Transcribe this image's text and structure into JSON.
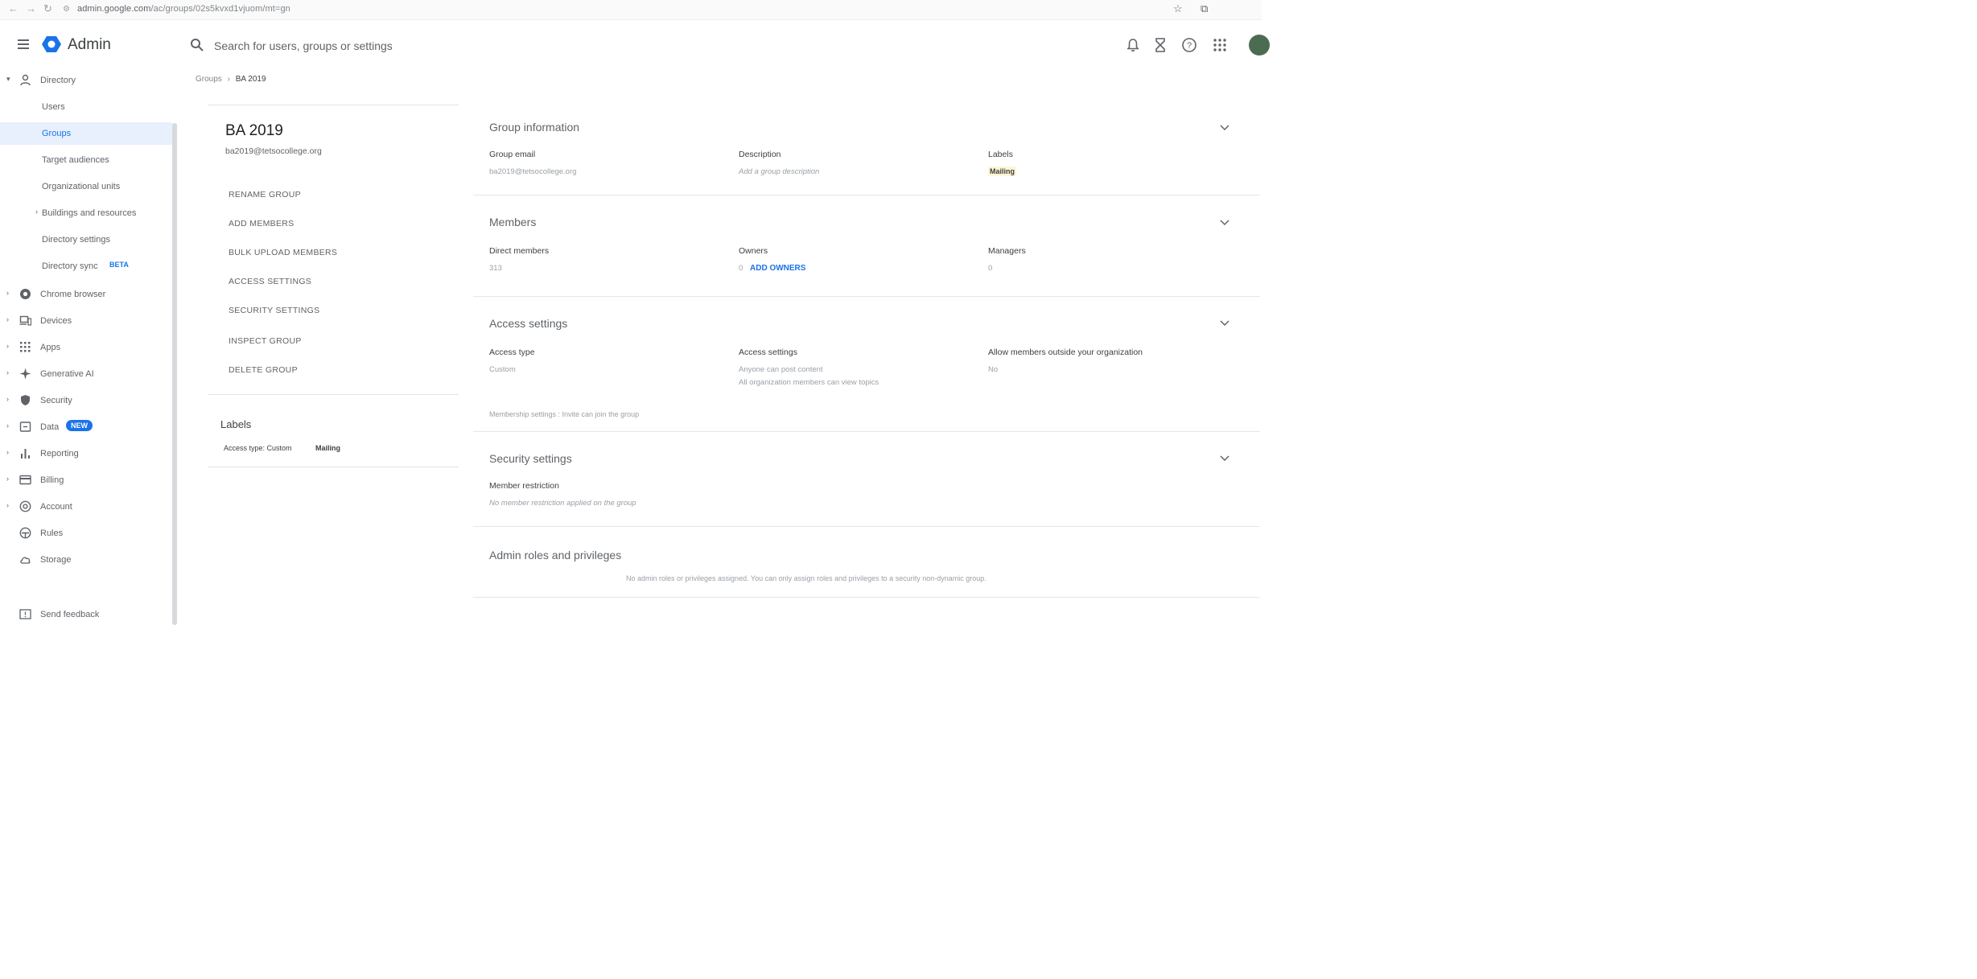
{
  "browser": {
    "url_domain": "admin.google.com",
    "url_path": "/ac/groups/02s5kvxd1vjuom/mt=gn"
  },
  "header": {
    "app_name": "Admin",
    "search_placeholder": "Search for users, groups or settings"
  },
  "sidebar": {
    "directory_label": "Directory",
    "directory_items": [
      {
        "label": "Users"
      },
      {
        "label": "Groups"
      },
      {
        "label": "Target audiences"
      },
      {
        "label": "Organizational units"
      },
      {
        "label": "Buildings and resources"
      },
      {
        "label": "Directory settings"
      },
      {
        "label": "Directory sync",
        "badge": "BETA"
      }
    ],
    "sections": [
      {
        "label": "Chrome browser",
        "icon": "chrome-icon"
      },
      {
        "label": "Devices",
        "icon": "devices-icon"
      },
      {
        "label": "Apps",
        "icon": "apps-grid-icon"
      },
      {
        "label": "Generative AI",
        "icon": "sparkle-icon"
      },
      {
        "label": "Security",
        "icon": "shield-icon"
      },
      {
        "label": "Data",
        "icon": "data-icon",
        "badge": "NEW"
      },
      {
        "label": "Reporting",
        "icon": "bar-chart-icon"
      },
      {
        "label": "Billing",
        "icon": "credit-card-icon"
      },
      {
        "label": "Account",
        "icon": "at-sign-icon"
      },
      {
        "label": "Rules",
        "icon": "rules-icon"
      },
      {
        "label": "Storage",
        "icon": "cloud-icon"
      }
    ],
    "feedback_label": "Send feedback"
  },
  "breadcrumb": {
    "parent": "Groups",
    "separator": "›",
    "current": "BA 2019"
  },
  "group_card": {
    "name": "BA 2019",
    "email": "ba2019@tetsocollege.org",
    "actions": [
      "RENAME GROUP",
      "ADD MEMBERS",
      "BULK UPLOAD MEMBERS",
      "ACCESS SETTINGS",
      "SECURITY SETTINGS",
      "INSPECT GROUP",
      "DELETE GROUP"
    ],
    "labels_title": "Labels",
    "labels": [
      "Access type: Custom",
      "Mailing"
    ]
  },
  "group_info": {
    "title": "Group information",
    "email_label": "Group email",
    "email_value": "ba2019@tetsocollege.org",
    "description_label": "Description",
    "description_value": "Add a group description",
    "labels_label": "Labels",
    "labels_value": "Mailing"
  },
  "members": {
    "title": "Members",
    "direct_label": "Direct members",
    "direct_value": "313",
    "owners_label": "Owners",
    "owners_value": "0",
    "add_owners": "ADD OWNERS",
    "managers_label": "Managers",
    "managers_value": "0"
  },
  "access": {
    "title": "Access settings",
    "type_label": "Access type",
    "type_value": "Custom",
    "settings_label": "Access settings",
    "settings_line1": "Anyone can post content",
    "settings_line2": "All organization members can view topics",
    "outside_label": "Allow members outside your organization",
    "outside_value": "No",
    "membership_note": "Membership settings : Invite can join the group"
  },
  "security": {
    "title": "Security settings",
    "restriction_label": "Member restriction",
    "restriction_value": "No member restriction applied on the group"
  },
  "admin_roles": {
    "title": "Admin roles and privileges",
    "message": "No admin roles or privileges assigned. You can only assign roles and privileges to a security non-dynamic group."
  },
  "colors": {
    "accent": "#1a73e8",
    "selected_bg": "#e8f0fe",
    "text": "#3c4043",
    "muted": "#9aa0a6"
  }
}
